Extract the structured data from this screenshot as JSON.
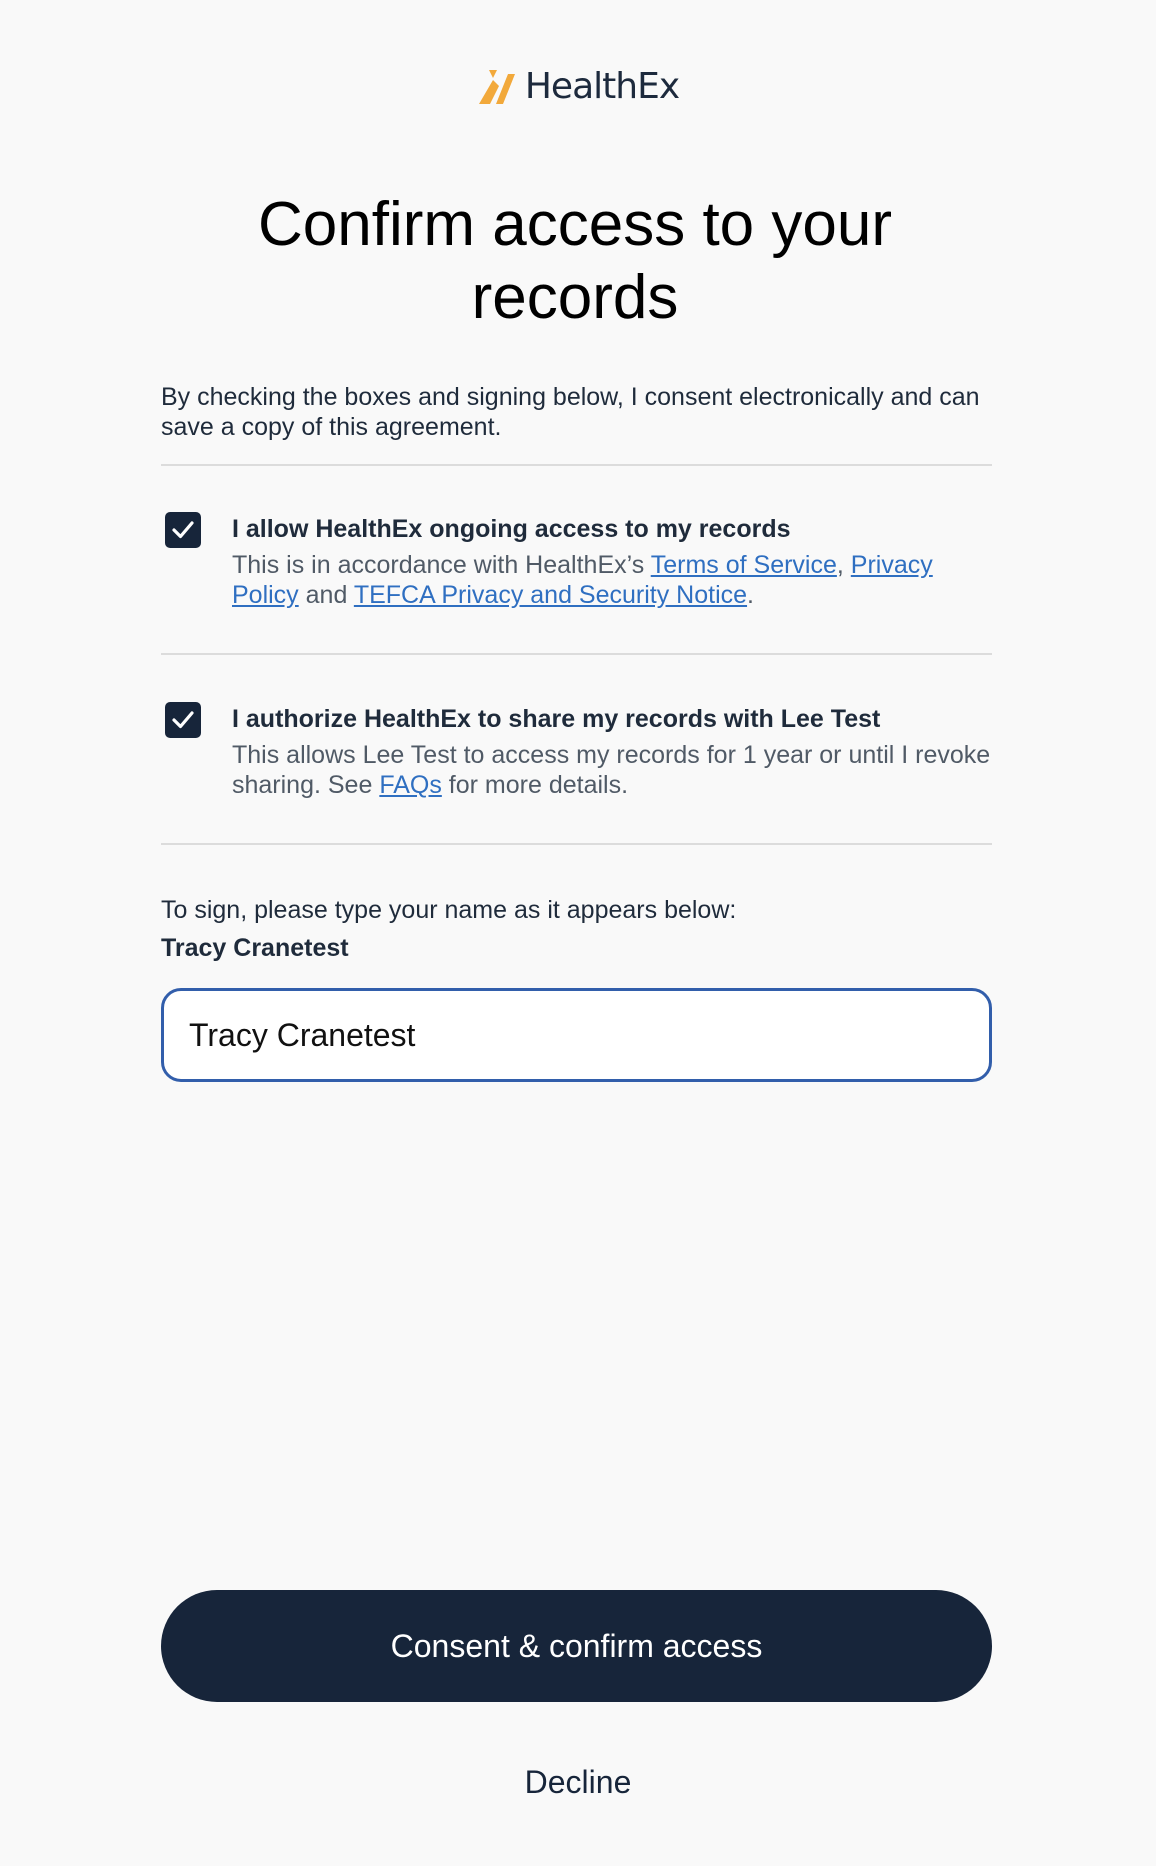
{
  "brand": {
    "name": "HealthEx",
    "logo_icon": "healthex-logo-icon",
    "accent_color": "#f2a93b"
  },
  "page": {
    "title": "Confirm access to your records",
    "intro": "By checking the boxes and signing below, I consent electronically and can save a copy of this agreement."
  },
  "consents": [
    {
      "checked": true,
      "title": "I allow HealthEx ongoing access to my records",
      "desc_prefix": "This is in accordance with HealthEx’s ",
      "link1": "Terms of Service",
      "sep1": ", ",
      "link2": "Privacy Policy",
      "sep2": " and ",
      "link3": "TEFCA Privacy and Security Notice",
      "suffix": "."
    },
    {
      "checked": true,
      "title": "I authorize HealthEx to share my records with Lee Test",
      "desc_prefix": "This allows Lee Test to access my records for 1 year or until I revoke sharing. See ",
      "link1": "FAQs",
      "suffix": " for more details."
    }
  ],
  "signature": {
    "label": "To sign, please type your name as it appears below:",
    "expected_name": "Tracy Cranetest",
    "input_value": "Tracy Cranetest"
  },
  "actions": {
    "primary_label": "Consent & confirm access",
    "decline_label": "Decline"
  },
  "colors": {
    "primary": "#17253a",
    "link": "#2f6fc1",
    "input_border": "#325eab"
  }
}
